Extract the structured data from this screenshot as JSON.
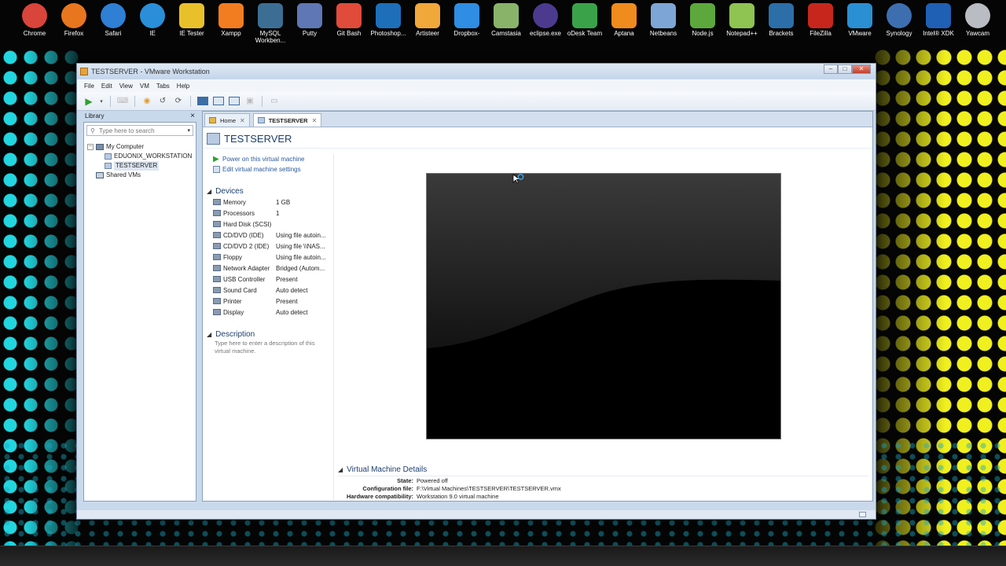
{
  "desktop": {
    "icons": [
      {
        "label": "Chrome",
        "icon": "chrome-icon",
        "color": "#d9443b"
      },
      {
        "label": "Firefox",
        "icon": "firefox-icon",
        "color": "#e8761e"
      },
      {
        "label": "Safari",
        "icon": "safari-icon",
        "color": "#2f7fd4"
      },
      {
        "label": "IE",
        "icon": "ie-icon",
        "color": "#2a8fd8"
      },
      {
        "label": "IE Tester",
        "icon": "ie-tester-icon",
        "color": "#e8c12a"
      },
      {
        "label": "Xampp",
        "icon": "xampp-icon",
        "color": "#f27d21"
      },
      {
        "label": "MySQL Workben...",
        "icon": "mysql-workbench-icon",
        "color": "#3c6e94"
      },
      {
        "label": "Putty",
        "icon": "putty-icon",
        "color": "#5f77b5"
      },
      {
        "label": "Git Bash",
        "icon": "git-bash-icon",
        "color": "#e04b3a"
      },
      {
        "label": "Photoshop...",
        "icon": "photoshop-icon",
        "color": "#1d6fba"
      },
      {
        "label": "Artisteer",
        "icon": "artisteer-icon",
        "color": "#f0a83a"
      },
      {
        "label": "Dropbox-",
        "icon": "dropbox-icon",
        "color": "#2f8de4"
      },
      {
        "label": "Camstasia",
        "icon": "camtasia-icon",
        "color": "#8ab36a"
      },
      {
        "label": "eclipse.exe",
        "icon": "eclipse-icon",
        "color": "#4b3a8e"
      },
      {
        "label": "oDesk Team",
        "icon": "odesk-icon",
        "color": "#3aa34a"
      },
      {
        "label": "Aptana",
        "icon": "aptana-icon",
        "color": "#f08b1e"
      },
      {
        "label": "Netbeans",
        "icon": "netbeans-icon",
        "color": "#7da6d6"
      },
      {
        "label": "Node.js",
        "icon": "nodejs-icon",
        "color": "#5da83d"
      },
      {
        "label": "Notepad++",
        "icon": "notepad-plus-plus-icon",
        "color": "#8fc352"
      },
      {
        "label": "Brackets",
        "icon": "brackets-icon",
        "color": "#2b6ea8"
      },
      {
        "label": "FileZilla",
        "icon": "filezilla-icon",
        "color": "#c7261d"
      },
      {
        "label": "VMware",
        "icon": "vmware-icon",
        "color": "#2b8fd3"
      },
      {
        "label": "Synology",
        "icon": "synology-icon",
        "color": "#3d6fb0"
      },
      {
        "label": "Intel® XDK",
        "icon": "intel-xdk-icon",
        "color": "#1f5fb4"
      },
      {
        "label": "Yawcam",
        "icon": "yawcam-icon",
        "color": "#b9bcc2"
      }
    ]
  },
  "window": {
    "title": "TESTSERVER - VMware Workstation",
    "menu": [
      "File",
      "Edit",
      "View",
      "VM",
      "Tabs",
      "Help"
    ]
  },
  "library": {
    "title": "Library",
    "close": "×",
    "search_placeholder": "Type here to search",
    "tree": {
      "root": "My Computer",
      "vms": [
        "EDUONIX_WORKSTATION",
        "TESTSERVER"
      ],
      "shared": "Shared VMs"
    }
  },
  "tabs": [
    {
      "label": "Home"
    },
    {
      "label": "TESTSERVER"
    }
  ],
  "vm": {
    "name": "TESTSERVER",
    "actions": {
      "power_on": "Power on this virtual machine",
      "edit_settings": "Edit virtual machine settings"
    },
    "devices_title": "Devices",
    "devices": [
      {
        "name": "Memory",
        "value": "1 GB"
      },
      {
        "name": "Processors",
        "value": "1"
      },
      {
        "name": "Hard Disk (SCSI)",
        "value": ""
      },
      {
        "name": "CD/DVD (IDE)",
        "value": "Using file autoin..."
      },
      {
        "name": "CD/DVD 2 (IDE)",
        "value": "Using file \\\\NAS..."
      },
      {
        "name": "Floppy",
        "value": "Using file autoin..."
      },
      {
        "name": "Network Adapter",
        "value": "Bridged (Autom..."
      },
      {
        "name": "USB Controller",
        "value": "Present"
      },
      {
        "name": "Sound Card",
        "value": "Auto detect"
      },
      {
        "name": "Printer",
        "value": "Present"
      },
      {
        "name": "Display",
        "value": "Auto detect"
      }
    ],
    "description_title": "Description",
    "description_placeholder": "Type here to enter a description of this virtual machine.",
    "details_title": "Virtual Machine Details",
    "details": [
      {
        "label": "State:",
        "value": "Powered off"
      },
      {
        "label": "Configuration file:",
        "value": "F:\\Virtual Machines\\TESTSERVER\\TESTSERVER.vmx"
      },
      {
        "label": "Hardware compatibility:",
        "value": "Workstation 9.0 virtual machine"
      }
    ]
  }
}
